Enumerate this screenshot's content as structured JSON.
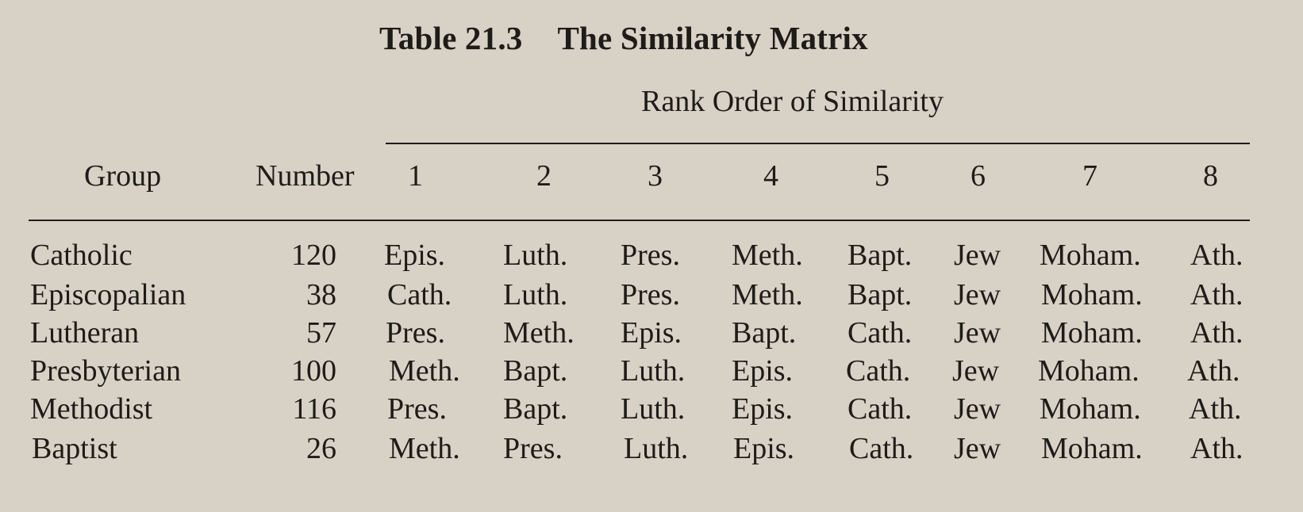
{
  "table": {
    "title_number": "Table 21.3",
    "title_text": "The Similarity Matrix",
    "rank_header": "Rank Order of Similarity",
    "headers": {
      "group": "Group",
      "number": "Number",
      "ranks": [
        "1",
        "2",
        "3",
        "4",
        "5",
        "6",
        "7",
        "8"
      ]
    },
    "rows": [
      {
        "group": "Catholic",
        "number": "120",
        "ranks": [
          "Epis.",
          "Luth.",
          "Pres.",
          "Meth.",
          "Bapt.",
          "Jew",
          "Moham.",
          "Ath."
        ]
      },
      {
        "group": "Episcopalian",
        "number": "38",
        "ranks": [
          "Cath.",
          "Luth.",
          "Pres.",
          "Meth.",
          "Bapt.",
          "Jew",
          "Moham.",
          "Ath."
        ]
      },
      {
        "group": "Lutheran",
        "number": "57",
        "ranks": [
          "Pres.",
          "Meth.",
          "Epis.",
          "Bapt.",
          "Cath.",
          "Jew",
          "Moham.",
          "Ath."
        ]
      },
      {
        "group": "Presbyterian",
        "number": "100",
        "ranks": [
          "Meth.",
          "Bapt.",
          "Luth.",
          "Epis.",
          "Cath.",
          "Jew",
          "Moham.",
          "Ath."
        ]
      },
      {
        "group": "Methodist",
        "number": "116",
        "ranks": [
          "Pres.",
          "Bapt.",
          "Luth.",
          "Epis.",
          "Cath.",
          "Jew",
          "Moham.",
          "Ath."
        ]
      },
      {
        "group": "Baptist",
        "number": "26",
        "ranks": [
          "Meth.",
          "Pres.",
          "Luth.",
          "Epis.",
          "Cath.",
          "Jew",
          "Moham.",
          "Ath."
        ]
      }
    ]
  }
}
